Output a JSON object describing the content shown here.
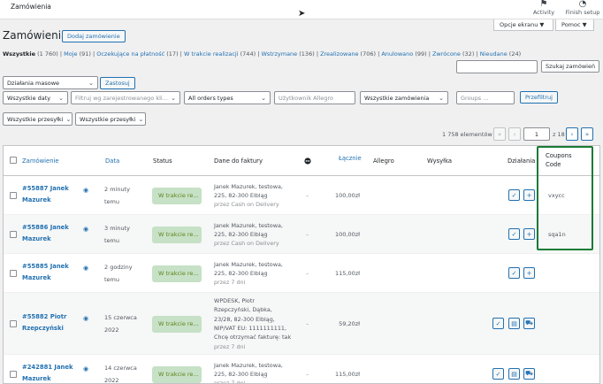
{
  "topbar": {
    "site_title": "Zamówienia",
    "activity_label": "Activity",
    "finish_label": "Finish setup"
  },
  "screen_options": {
    "label": "Opcje ekranu ▼",
    "help": "Pomoc ▼"
  },
  "page_title": "Zamówienia",
  "add_button": "Dodaj zamówienie",
  "subsubsub": [
    {
      "label": "Wszystkie",
      "count": "(1 760)",
      "current": true
    },
    {
      "label": "Moje",
      "count": "(91)"
    },
    {
      "label": "Oczekujące na płatność",
      "count": "(17)"
    },
    {
      "label": "W trakcie realizacji",
      "count": "(744)"
    },
    {
      "label": "Wstrzymane",
      "count": "(136)"
    },
    {
      "label": "Zrealizowane",
      "count": "(706)"
    },
    {
      "label": "Anulowano",
      "count": "(99)"
    },
    {
      "label": "Zwrócone",
      "count": "(32)"
    },
    {
      "label": "Nieudane",
      "count": "(24)"
    }
  ],
  "search": {
    "value": "",
    "button": "Szukaj zamówień"
  },
  "bulk": {
    "selected": "Działania masowe",
    "apply": "Zastosuj"
  },
  "filters": {
    "dates": "Wszystkie daty",
    "customer_placeholder": "Filtruj wg zarejestrowanego kli...",
    "order_types": "All orders types",
    "allegro_user_placeholder": "Użytkownik Allegro",
    "all_orders": "Wszystkie zamówienia",
    "groups_placeholder": "Groups ...",
    "filter_button": "Przefiltruj",
    "shipments1": "Wszystkie przesyłki",
    "shipments2": "Wszystkie przesyłki"
  },
  "pagination": {
    "count": "1 758 elementów",
    "first": "«",
    "prev": "‹",
    "current": "1",
    "of": "z 18",
    "next": "›",
    "last": "»"
  },
  "columns": {
    "order": "Zamówienie",
    "date": "Data",
    "status": "Status",
    "billing": "Dane do faktury",
    "total": "Łącznie",
    "allegro": "Allegro",
    "shipping": "Wysyłka",
    "actions": "Działania",
    "coupons_l1": "Coupons",
    "coupons_l2": "Code"
  },
  "orders": [
    {
      "id_l1": "#55887 Janek",
      "id_l2": "Mazurek",
      "date_l1": "2 minuty",
      "date_l2": "temu",
      "status": "W trakcie re...",
      "billing": [
        "Janek Mazurek, testowa,",
        "225, 82-300 Elbląg"
      ],
      "via": "przez Cash on Delivery",
      "dash": "–",
      "total": "100,00zł",
      "coupon": "vxycc"
    },
    {
      "id_l1": "#55886 Janek",
      "id_l2": "Mazurek",
      "date_l1": "3 minuty",
      "date_l2": "temu",
      "status": "W trakcie re...",
      "billing": [
        "Janek Mazurek, testowa,",
        "225, 82-300 Elbląg"
      ],
      "via": "przez Cash on Delivery",
      "dash": "–",
      "total": "100,00zł",
      "coupon": "sqa1n"
    },
    {
      "id_l1": "#55885 Janek",
      "id_l2": "Mazurek",
      "date_l1": "2 godziny",
      "date_l2": "temu",
      "status": "W trakcie re...",
      "billing": [
        "Janek Mazurek, testowa,",
        "225, 82-300 Elbląg"
      ],
      "via": "przez 7 dni",
      "dash": "–",
      "total": "115,00zł",
      "coupon": ""
    },
    {
      "id_l1": "#55882 Piotr",
      "id_l2": "Rzepczyński",
      "date_l1": "15 czerwca",
      "date_l2": "2022",
      "status": "W trakcie re...",
      "billing": [
        "WPDESK, Piotr",
        "Rzepczyński, Dąbka,",
        "23/28, 82-300 Elbląg,",
        "NIP/VAT EU: 1111111111,",
        "Chcę otrzymać fakturę: tak"
      ],
      "via": "przez 7 dni",
      "dash": "–",
      "total": "59,20zł",
      "coupon": ""
    },
    {
      "id_l1": "#242881 Janek",
      "id_l2": "Mazurek",
      "date_l1": "14 czerwca",
      "date_l2": "2022",
      "status": "W trakcie re...",
      "billing": [
        "Janek Mazurek, testowa,",
        "225, 82-300 Elbląg"
      ],
      "via": "przez 7 dni",
      "dash": "–",
      "total": "115,00zł",
      "coupon": ""
    }
  ],
  "icons": {
    "flag": "flag-icon",
    "activity": "activity-icon",
    "eye": "eye-icon",
    "check": "check-icon",
    "plus": "plus-icon",
    "doc": "document-icon",
    "truck": "truck-icon",
    "cursor": "cursor-icon"
  },
  "colors": {
    "accent": "#2271b1",
    "status_bg": "#c6e1c6",
    "status_fg": "#5b841b",
    "highlight": "#1a7a36"
  }
}
